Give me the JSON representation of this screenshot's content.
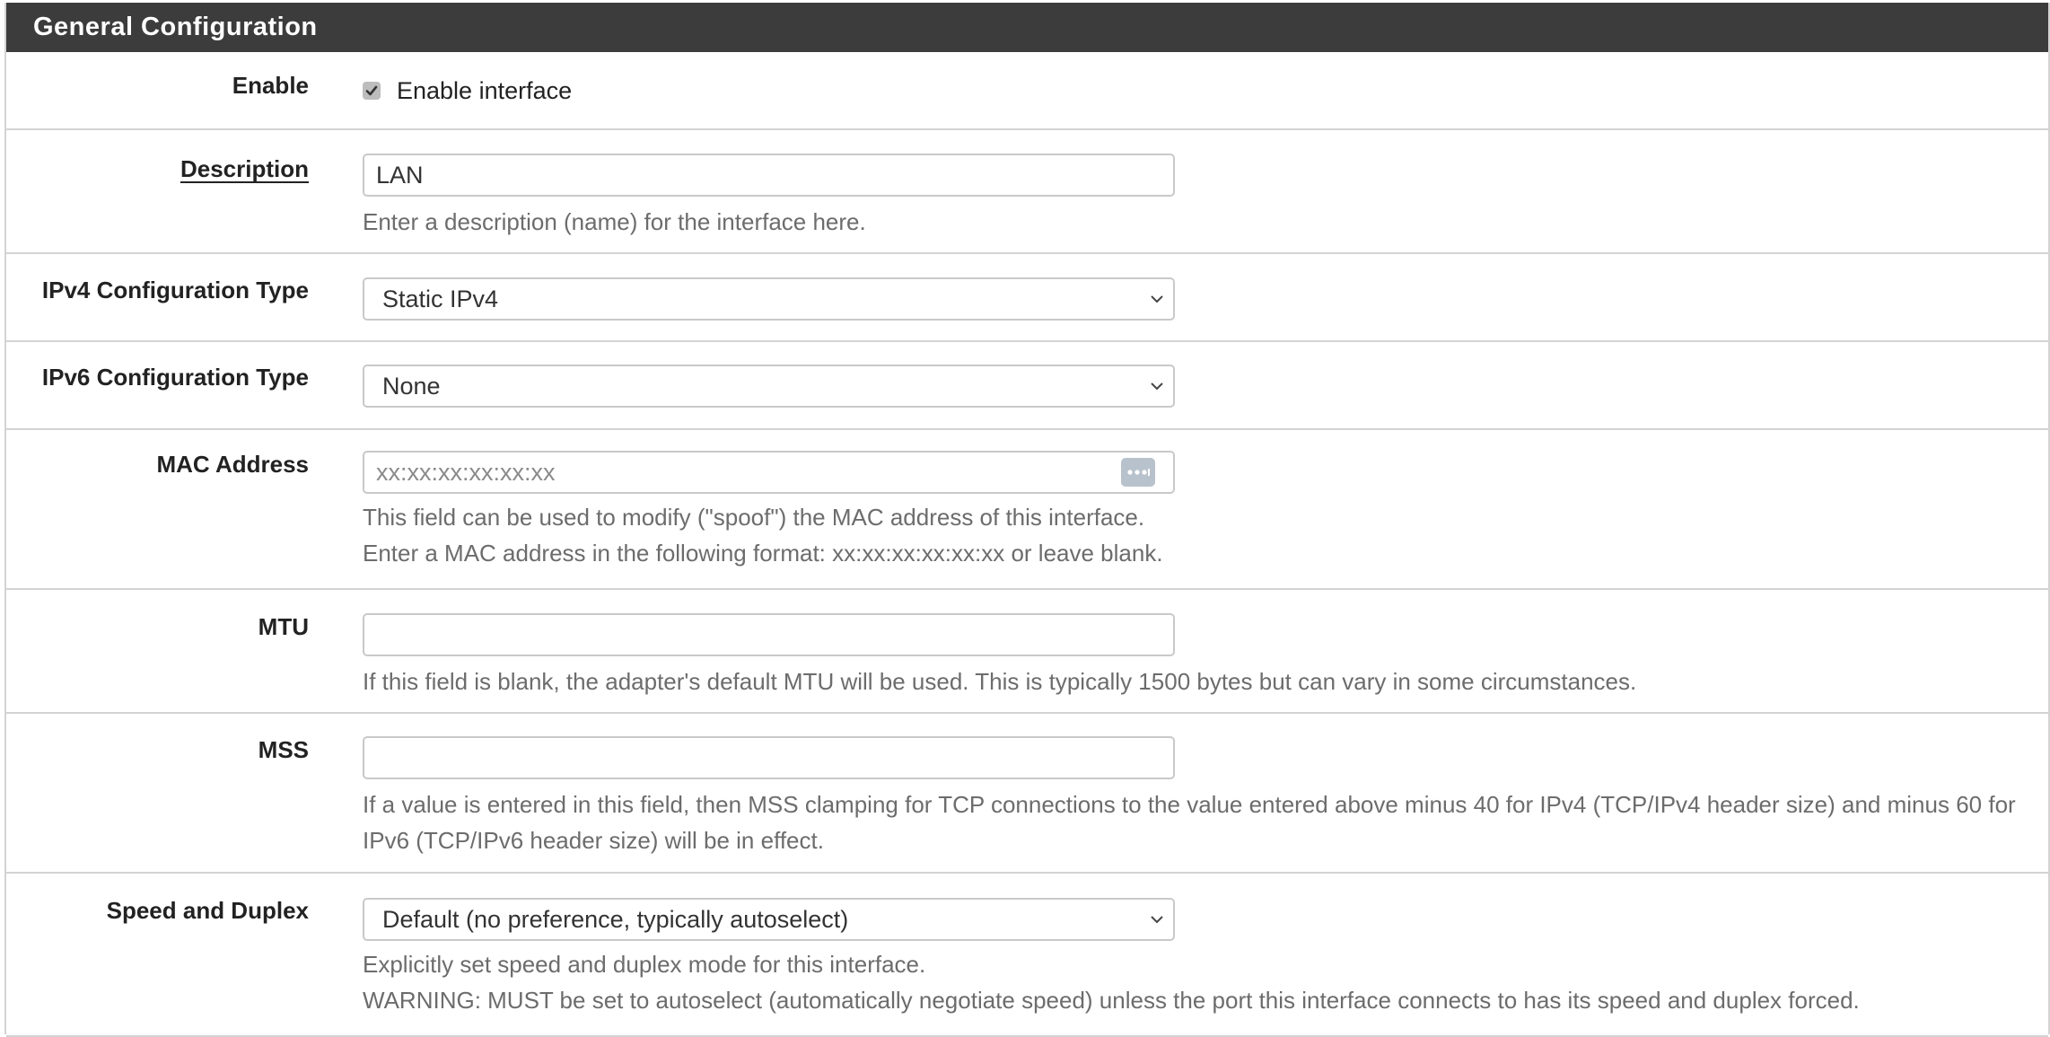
{
  "panel": {
    "title": "General Configuration"
  },
  "enable": {
    "label": "Enable",
    "checkbox_label": "Enable interface",
    "checked": true
  },
  "description": {
    "label": "Description",
    "value": "LAN",
    "help": "Enter a description (name) for the interface here."
  },
  "ipv4": {
    "label": "IPv4 Configuration Type",
    "selected": "Static IPv4"
  },
  "ipv6": {
    "label": "IPv6 Configuration Type",
    "selected": "None"
  },
  "mac": {
    "label": "MAC Address",
    "placeholder": "xx:xx:xx:xx:xx:xx",
    "value": "",
    "help_line1": "This field can be used to modify (\"spoof\") the MAC address of this interface.",
    "help_line2": "Enter a MAC address in the following format: xx:xx:xx:xx:xx:xx or leave blank."
  },
  "mtu": {
    "label": "MTU",
    "value": "",
    "help": "If this field is blank, the adapter's default MTU will be used. This is typically 1500 bytes but can vary in some circumstances."
  },
  "mss": {
    "label": "MSS",
    "value": "",
    "help": "If a value is entered in this field, then MSS clamping for TCP connections to the value entered above minus 40 for IPv4 (TCP/IPv4 header size) and minus 60 for IPv6 (TCP/IPv6 header size) will be in effect."
  },
  "speed_duplex": {
    "label": "Speed and Duplex",
    "selected": "Default (no preference, typically autoselect)",
    "help_line1": "Explicitly set speed and duplex mode for this interface.",
    "help_line2": "WARNING: MUST be set to autoselect (automatically negotiate speed) unless the port this interface connects to has its speed and duplex forced."
  },
  "icons": {
    "checkbox": "checkmark-icon",
    "select": "chevron-down-icon",
    "mac_button": "ellipsis-icon"
  },
  "colors": {
    "header_bg": "#3c3c3c",
    "header_text": "#ffffff",
    "row_divider": "#d3d3d3",
    "help_text": "#6c6c6c",
    "mac_button_bg": "#b8c2cc"
  }
}
